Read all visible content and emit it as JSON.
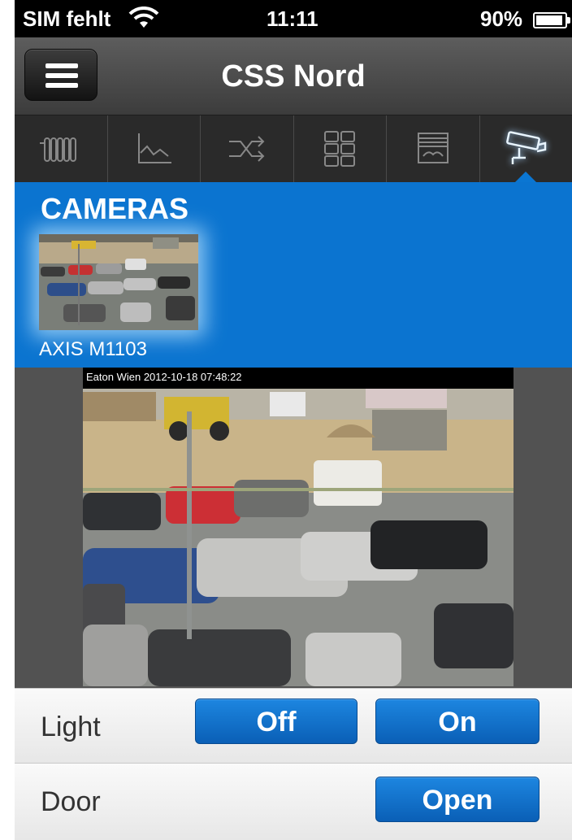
{
  "status_bar": {
    "carrier": "SIM fehlt",
    "time": "11:11",
    "battery": "90%"
  },
  "navbar": {
    "title": "CSS Nord"
  },
  "tabs": [
    {
      "icon": "radiator-icon"
    },
    {
      "icon": "chart-icon"
    },
    {
      "icon": "shuffle-icon"
    },
    {
      "icon": "grid-icon"
    },
    {
      "icon": "blind-icon"
    },
    {
      "icon": "security-camera-icon",
      "active": true
    }
  ],
  "cameras": {
    "heading": "CAMERAS",
    "items": [
      {
        "label": "AXIS M1103"
      }
    ]
  },
  "feed": {
    "overlay": "Eaton Wien 2012-10-18 07:48:22"
  },
  "controls": {
    "light": {
      "label": "Light",
      "off": "Off",
      "on": "On"
    },
    "door": {
      "label": "Door",
      "open": "Open"
    }
  },
  "colors": {
    "accent": "#0b74d0",
    "button": "#1677d4",
    "background": "#525252"
  }
}
